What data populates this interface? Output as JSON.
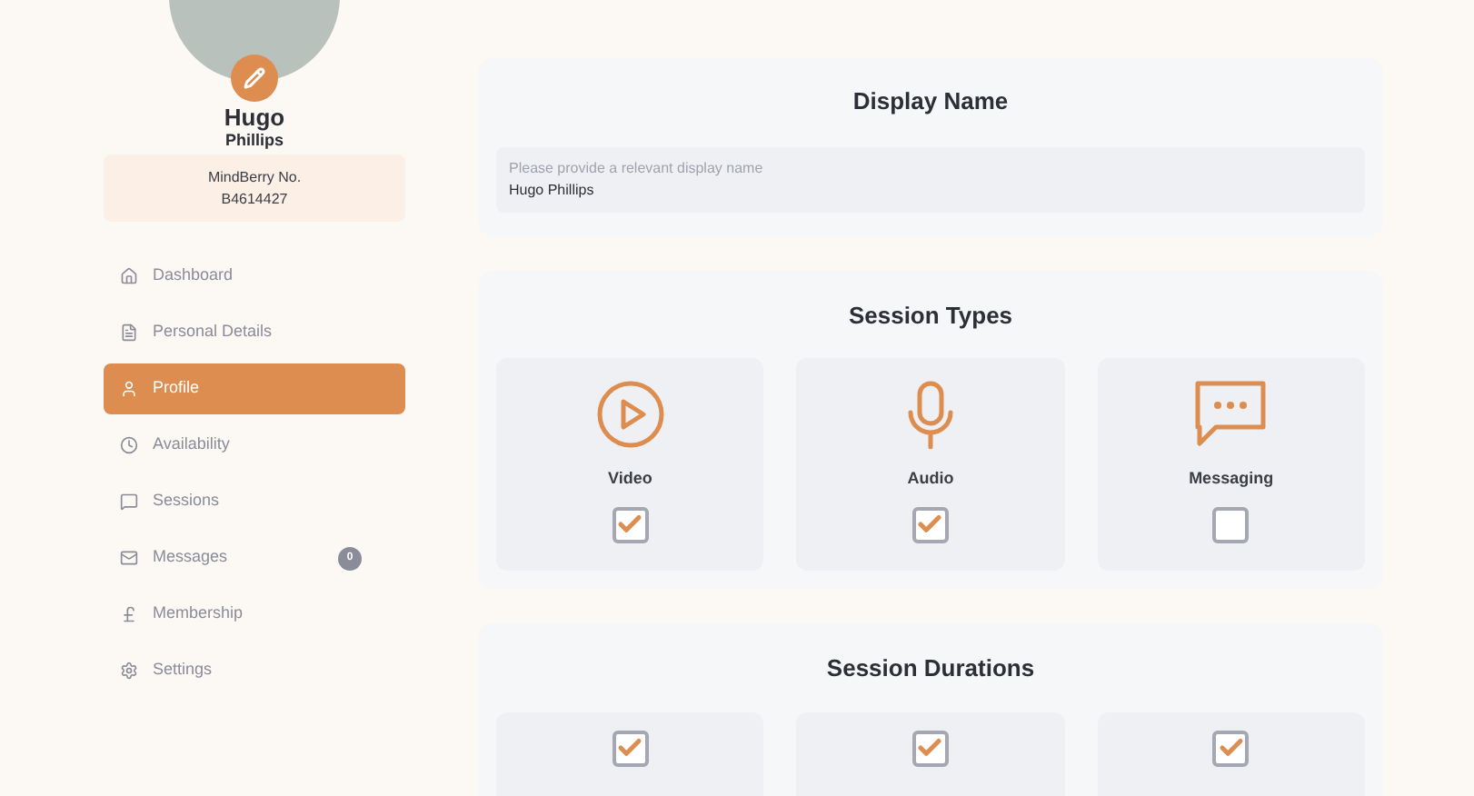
{
  "profile": {
    "first_name": "Hugo",
    "last_name": "Phillips",
    "member_label": "MindBerry No.",
    "member_number": "B4614427"
  },
  "nav": [
    {
      "label": "Dashboard",
      "kind": "home",
      "selected": false
    },
    {
      "label": "Personal Details",
      "kind": "details",
      "selected": false
    },
    {
      "label": "Profile",
      "kind": "user",
      "selected": true
    },
    {
      "label": "Availability",
      "kind": "clock",
      "selected": false
    },
    {
      "label": "Sessions",
      "kind": "chat",
      "selected": false
    },
    {
      "label": "Messages",
      "kind": "mail",
      "selected": false,
      "badge": "0"
    },
    {
      "label": "Membership",
      "kind": "pound",
      "selected": false
    },
    {
      "label": "Settings",
      "kind": "gear",
      "selected": false
    }
  ],
  "display_name": {
    "title": "Display Name",
    "label": "Please provide a relevant display name",
    "value": "Hugo Phillips"
  },
  "session_types": {
    "title": "Session Types",
    "items": [
      {
        "label": "Video",
        "kind": "video",
        "checked": true
      },
      {
        "label": "Audio",
        "kind": "audio",
        "checked": true
      },
      {
        "label": "Messaging",
        "kind": "message",
        "checked": false
      }
    ]
  },
  "session_durations": {
    "title": "Session Durations",
    "items": [
      {
        "checked": true
      },
      {
        "checked": true
      },
      {
        "checked": true
      }
    ]
  }
}
